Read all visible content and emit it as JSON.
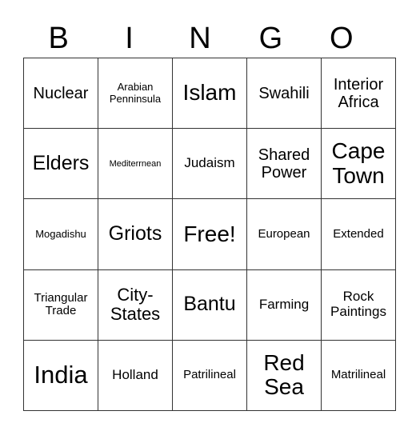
{
  "header": {
    "letters": [
      "B",
      "I",
      "N",
      "G",
      "O"
    ]
  },
  "card": {
    "rows": [
      [
        "Nuclear",
        "Arabian Penninsula",
        "Islam",
        "Swahili",
        "Interior Africa"
      ],
      [
        "Elders",
        "Mediterrnean",
        "Judaism",
        "Shared Power",
        "Cape Town"
      ],
      [
        "Mogadishu",
        "Griots",
        "Free!",
        "European",
        "Extended"
      ],
      [
        "Triangular Trade",
        "City-States",
        "Bantu",
        "Farming",
        "Rock Paintings"
      ],
      [
        "India",
        "Holland",
        "Patrilineal",
        "Red Sea",
        "Matrilineal"
      ]
    ],
    "free_space": "Free!"
  }
}
